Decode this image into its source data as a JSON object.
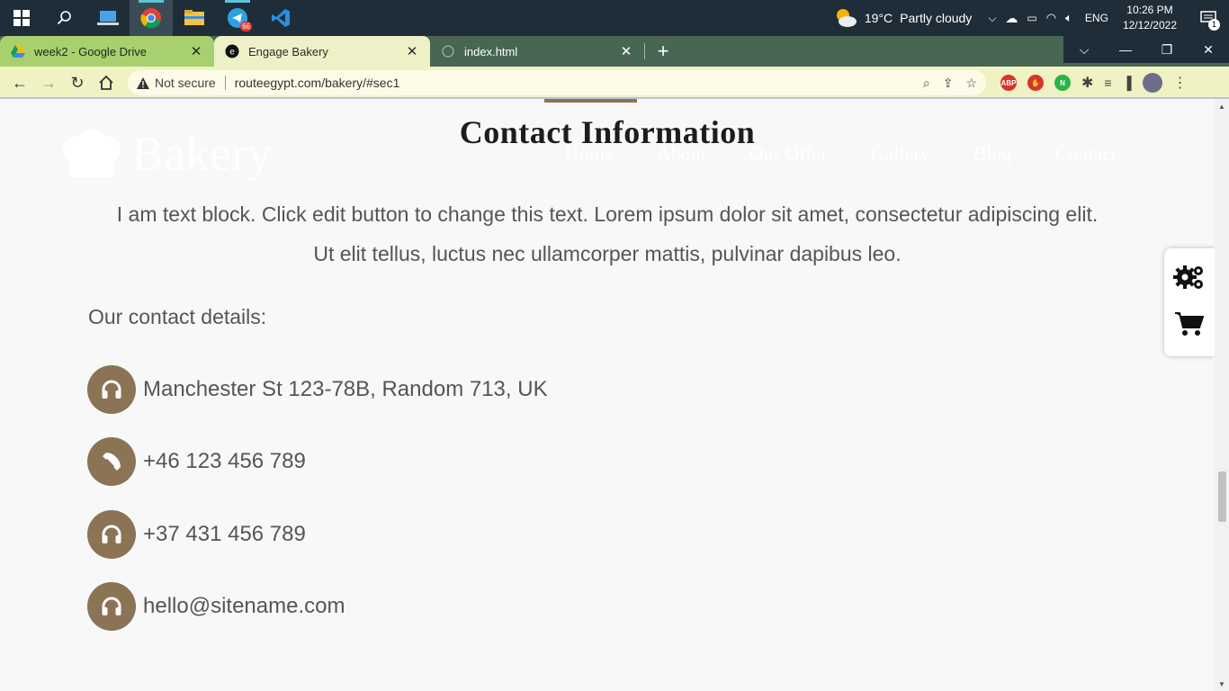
{
  "taskbar": {
    "weather": {
      "temp": "19°C",
      "desc": "Partly cloudy"
    },
    "lang": "ENG",
    "time": "10:26 PM",
    "date": "12/12/2022",
    "notif_count": "1",
    "telegram_badge": "66"
  },
  "browser": {
    "tabs": [
      {
        "title": "week2 - Google Drive",
        "close": "✕"
      },
      {
        "title": "Engage Bakery",
        "close": "✕"
      },
      {
        "title": "index.html",
        "close": "✕"
      }
    ],
    "new_tab": "+",
    "security_label": "Not secure",
    "url": "routeegypt.com/bakery/#sec1"
  },
  "page": {
    "brand": "Bakery",
    "nav": [
      "Home",
      "About",
      "Our Offer",
      "Gallery",
      "Blog",
      "Contact"
    ],
    "title": "Contact Information",
    "intro_line1": "I am text block. Click edit button to change this text. Lorem ipsum dolor sit amet, consectetur adipiscing elit.",
    "intro_line2": "Ut elit tellus, luctus nec ullamcorper mattis, pulvinar dapibus leo.",
    "contact_label": "Our contact details:",
    "contacts": [
      {
        "icon": "headphones-icon",
        "text": "Manchester St 123-78B, Random 713, UK"
      },
      {
        "icon": "phone-icon",
        "text": "+46 123 456 789"
      },
      {
        "icon": "headphones-icon",
        "text": "+37 431 456 789"
      },
      {
        "icon": "headphones-icon",
        "text": "hello@sitename.com"
      }
    ],
    "accent_color": "#8b7355"
  }
}
